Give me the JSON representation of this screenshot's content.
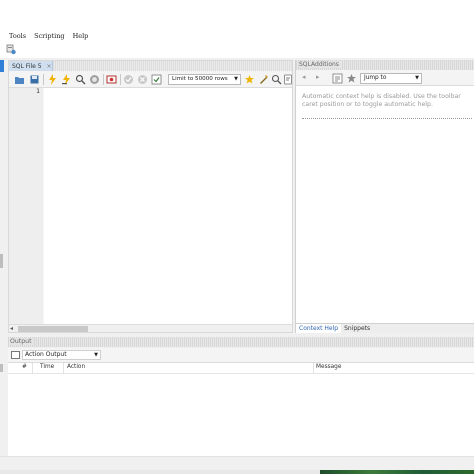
{
  "menu": [
    "Tools",
    "Scripting",
    "Help"
  ],
  "editor": {
    "tab_label": "SQL File 5",
    "tab_close": "×",
    "limit_select": "Limit to 50000 rows",
    "line_numbers": [
      "1"
    ]
  },
  "additions": {
    "title": "SQLAdditions",
    "jump_to": "Jump to",
    "help_text_line1": "Automatic context help is disabled. Use the toolbar",
    "help_text_line2": "caret position or to toggle automatic help.",
    "tabs": [
      "Context Help",
      "Snippets"
    ]
  },
  "output": {
    "title": "Output",
    "select": "Action Output",
    "columns": [
      "#",
      "Time",
      "Action",
      "Message"
    ]
  },
  "icons": {
    "home": "home-icon",
    "open": "folder-open-icon",
    "save": "save-icon",
    "execute": "lightning-icon",
    "execute_current": "lightning-cursor-icon",
    "explain": "magnifier-lightning-icon",
    "stop": "stop-icon",
    "toggle_output": "toggle-output-icon",
    "commit": "check-circle-icon",
    "rollback": "cancel-circle-icon",
    "autocommit": "autocommit-icon",
    "beautify": "beautify-icon",
    "find": "find-icon",
    "invisible": "invisible-chars-icon",
    "wrap": "word-wrap-icon"
  },
  "colors": {
    "accent": "#2f7fd6",
    "tab_active": "#d0dff0",
    "help_text": "#9a9a9a"
  }
}
